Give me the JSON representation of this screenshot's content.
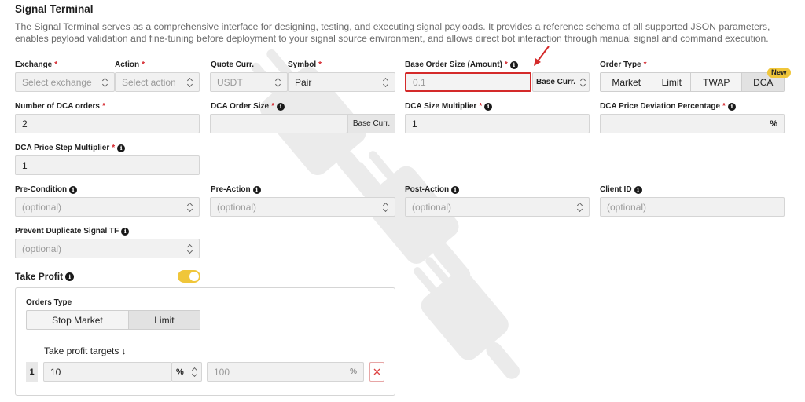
{
  "page": {
    "title": "Signal Terminal",
    "description": "The Signal Terminal serves as a comprehensive interface for designing, testing, and executing signal payloads. It provides a reference schema of all supported JSON parameters, enables payload validation and fine-tuning before deployment to your signal source environment, and allows direct bot interaction through manual signal and command execution."
  },
  "required_mark": "*",
  "info_glyph": "i",
  "exchange": {
    "label": "Exchange",
    "placeholder": "Select exchange"
  },
  "action": {
    "label": "Action",
    "placeholder": "Select action"
  },
  "quote_curr": {
    "label": "Quote Curr.",
    "value": "USDT"
  },
  "symbol": {
    "label": "Symbol",
    "value": "Pair"
  },
  "base_order_size": {
    "label": "Base Order Size (Amount)",
    "value": "0.1",
    "suffix": "Base Curr."
  },
  "order_type": {
    "label": "Order Type",
    "options": [
      "Market",
      "Limit",
      "TWAP",
      "DCA"
    ],
    "selected": "DCA",
    "badge": "New"
  },
  "dca_orders": {
    "label": "Number of DCA orders",
    "value": "2"
  },
  "dca_order_size": {
    "label": "DCA Order Size",
    "value": "",
    "suffix": "Base Curr."
  },
  "dca_size_multiplier": {
    "label": "DCA Size Multiplier",
    "value": "1"
  },
  "dca_price_deviation": {
    "label": "DCA Price Deviation Percentage",
    "value": "",
    "unit": "%"
  },
  "dca_price_step": {
    "label": "DCA Price Step Multiplier",
    "value": "1"
  },
  "pre_condition": {
    "label": "Pre-Condition",
    "placeholder": "(optional)"
  },
  "pre_action": {
    "label": "Pre-Action",
    "placeholder": "(optional)"
  },
  "post_action": {
    "label": "Post-Action",
    "placeholder": "(optional)"
  },
  "client_id": {
    "label": "Client ID",
    "placeholder": "(optional)"
  },
  "prevent_duplicate": {
    "label": "Prevent Duplicate Signal TF",
    "placeholder": "(optional)"
  },
  "take_profit": {
    "label": "Take Profit",
    "enabled": true,
    "orders_type_label": "Orders Type",
    "orders_type_options": [
      "Stop Market",
      "Limit"
    ],
    "orders_type_selected": "Limit",
    "targets_label": "Take profit targets ↓",
    "targets": [
      {
        "index": "1",
        "value": "10",
        "unit": "%",
        "amount": "100",
        "amount_unit": "%"
      }
    ]
  },
  "colors": {
    "accent_yellow": "#f0c63a",
    "highlight_red": "#d42a2a",
    "required_red": "#d4242b"
  }
}
